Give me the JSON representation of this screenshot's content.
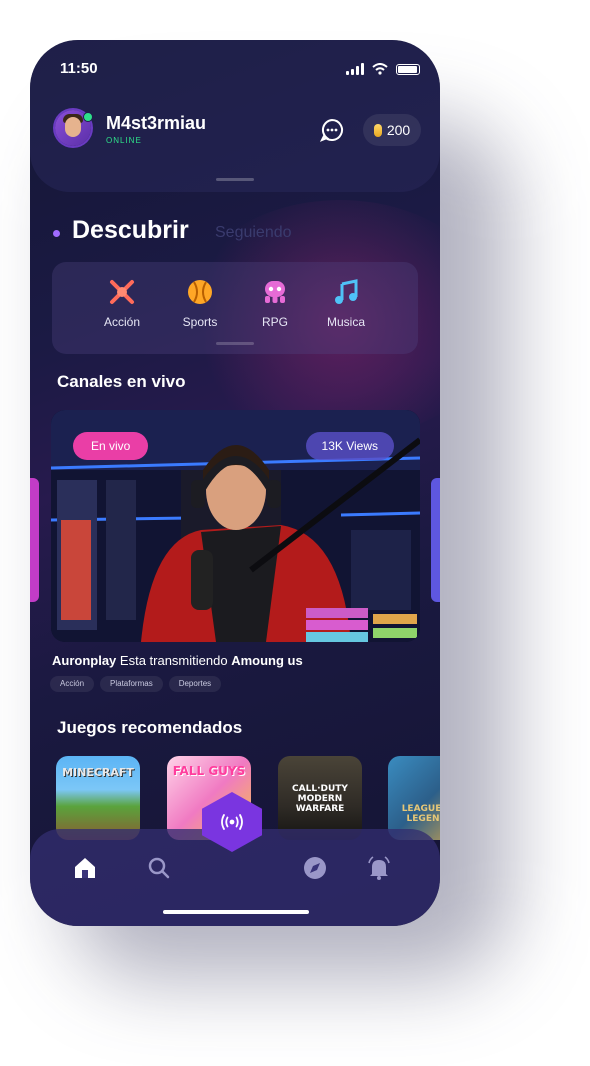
{
  "status_bar": {
    "time": "11:50"
  },
  "user": {
    "name": "M4st3rmiau",
    "status": "ONLINE",
    "coins": "200"
  },
  "tabs": {
    "active": "Descubrir",
    "inactive": "Seguiendo"
  },
  "categories": [
    {
      "label": "Acción",
      "icon": "swords-icon",
      "color": "#ff6b5a"
    },
    {
      "label": "Sports",
      "icon": "ball-icon",
      "color": "#ffa726"
    },
    {
      "label": "RPG",
      "icon": "monster-icon",
      "color": "#e66bd6"
    },
    {
      "label": "Musica",
      "icon": "music-note-icon",
      "color": "#4fc3f7"
    }
  ],
  "live_section": {
    "title": "Canales en vivo",
    "badge_live": "En vivo",
    "badge_views": "13K Views",
    "streamer": "Auronplay",
    "middle_text": " Esta transmitiendo ",
    "game": "Amoung us",
    "tags": [
      "Acción",
      "Plataformas",
      "Deportes"
    ]
  },
  "games_section": {
    "title": "Juegos recomendados",
    "games": [
      {
        "name": "Minecraft",
        "label": "MINECRAFT"
      },
      {
        "name": "Fall Guys",
        "label": "FALL GUYS"
      },
      {
        "name": "Call of Duty Modern Warfare",
        "label": "CALL·DUTY MODERN WARFARE"
      },
      {
        "name": "League of Legends",
        "label": "LEAGUE OF LEGENDS"
      }
    ]
  },
  "colors": {
    "accent": "#7a35e0",
    "live_pink": "#ea3ea6",
    "online_green": "#2ee08a"
  }
}
